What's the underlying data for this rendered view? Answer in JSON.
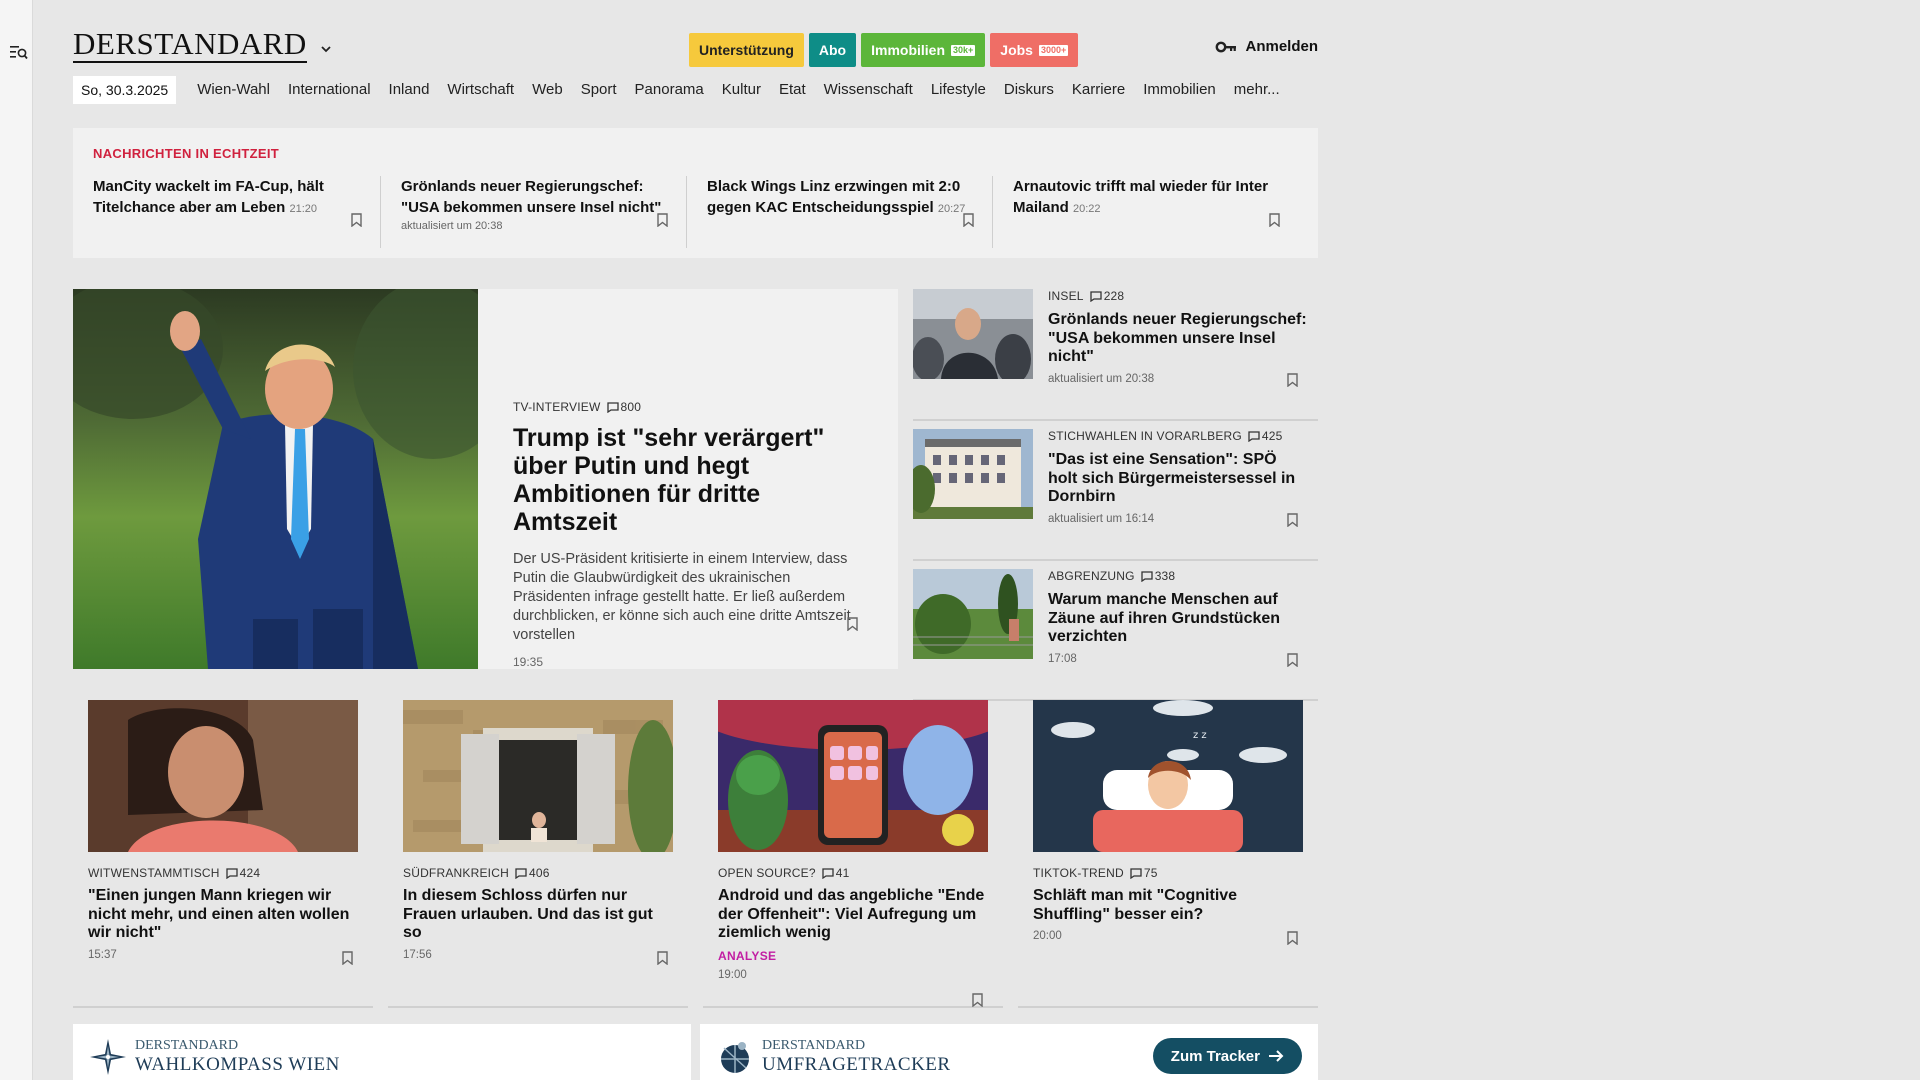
{
  "header": {
    "logo": "DERSTANDARD",
    "pills": {
      "support": "Unterstützung",
      "abo": "Abo",
      "immo": "Immobilien",
      "immo_badge": "30k+",
      "jobs": "Jobs",
      "jobs_badge": "3000+"
    },
    "login": "Anmelden"
  },
  "nav": {
    "date": "So, 30.3.2025",
    "items": [
      "Wien-Wahl",
      "International",
      "Inland",
      "Wirtschaft",
      "Web",
      "Sport",
      "Panorama",
      "Kultur",
      "Etat",
      "Wissenschaft",
      "Lifestyle",
      "Diskurs",
      "Karriere",
      "Immobilien",
      "mehr..."
    ]
  },
  "ticker": {
    "title": "NACHRICHTEN IN ECHTZEIT",
    "items": [
      {
        "headline": "ManCity wackelt im FA-Cup, hält Titelchance aber am Leben",
        "time": "21:20",
        "sub": ""
      },
      {
        "headline": "Grönlands neuer Regierungschef: \"USA bekommen unsere Insel nicht\"",
        "time": "",
        "sub": "aktualisiert um 20:38"
      },
      {
        "headline": "Black Wings Linz erzwingen mit 2:0 gegen KAC Entscheidungsspiel",
        "time": "20:27",
        "sub": ""
      },
      {
        "headline": "Arnautovic trifft mal wieder für Inter Mailand",
        "time": "20:22",
        "sub": ""
      }
    ]
  },
  "lead": {
    "kicker": "TV-INTERVIEW",
    "comments": "800",
    "title": "Trump ist \"sehr verärgert\" über Putin und hegt Ambitionen für dritte Amtszeit",
    "text": "Der US-Präsident kritisierte in einem Interview, dass Putin die Glaubwürdigkeit des ukrainischen Präsidenten infrage gestellt hatte. Er ließ außerdem durchblicken, er könne sich auch eine dritte Amtszeit vorstellen",
    "time": "19:35"
  },
  "side": [
    {
      "kicker": "INSEL",
      "comments": "228",
      "title": "Grönlands neuer Regierungschef: \"USA bekommen unsere Insel nicht\"",
      "meta": "aktualisiert um 20:38"
    },
    {
      "kicker": "STICHWAHLEN IN VORARLBERG",
      "comments": "425",
      "title": "\"Das ist eine Sensation\": SPÖ holt sich Bürgermeistersessel in Dornbirn",
      "meta": "aktualisiert um 16:14"
    },
    {
      "kicker": "ABGRENZUNG",
      "comments": "338",
      "title": "Warum manche Menschen auf Zäune auf ihren Grundstücken verzichten",
      "meta": "17:08"
    }
  ],
  "cards": [
    {
      "kicker": "WITWENSTAMMTISCH",
      "comments": "424",
      "title": "\"Einen jungen Mann kriegen wir nicht mehr, und einen alten wollen wir nicht\"",
      "tag": "",
      "meta": "15:37"
    },
    {
      "kicker": "SÜDFRANKREICH",
      "comments": "406",
      "title": "In diesem Schloss dürfen nur Frauen urlauben. Und das ist gut so",
      "tag": "",
      "meta": "17:56"
    },
    {
      "kicker": "OPEN SOURCE?",
      "comments": "41",
      "title": "Android und das angebliche \"Ende der Offenheit\": Viel Aufregung um ziemlich wenig",
      "tag": "ANALYSE",
      "meta": "19:00"
    },
    {
      "kicker": "TIKTOK-TREND",
      "comments": "75",
      "title": "Schläft man mit \"Cognitive Shuffling\" besser ein?",
      "tag": "",
      "meta": "20:00"
    }
  ],
  "promos": {
    "left": {
      "brand": "DERSTANDARD",
      "name": "WAHLKOMPASS WIEN"
    },
    "right": {
      "brand": "DERSTANDARD",
      "name": "UMFRAGETRACKER",
      "button": "Zum Tracker"
    }
  },
  "colors": {
    "accent_red": "#d0213e",
    "analyse_magenta": "#c21ea3",
    "support": "#f6c93c",
    "abo": "#0e8d87",
    "immo": "#5cb63a",
    "jobs": "#ef6e66",
    "tracker_button": "#144e63"
  }
}
